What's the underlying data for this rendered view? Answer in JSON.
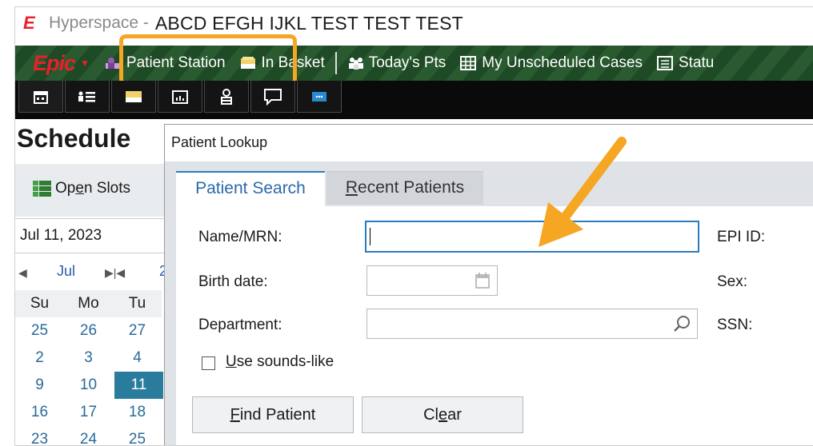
{
  "window": {
    "app_name": "Hyperspace -",
    "patient_name": "ABCD EFGH IJKL TEST TEST TEST"
  },
  "toolbar": {
    "epic_label": "Epic",
    "items": [
      {
        "label": "Patient Station",
        "icon": "patient-station-icon"
      },
      {
        "label": "In Basket",
        "icon": "in-basket-icon"
      },
      {
        "label": "Today's Pts",
        "icon": "todays-pts-icon"
      },
      {
        "label": "My Unscheduled Cases",
        "icon": "unscheduled-cases-icon"
      },
      {
        "label": "Statu",
        "icon": "status-icon"
      }
    ]
  },
  "icon_tabs": [
    "calendar-icon",
    "list-icon",
    "inbox-icon",
    "chart-icon",
    "person-icon",
    "chat-icon",
    "message-icon"
  ],
  "schedule": {
    "title": "Schedule",
    "open_slots_prefix": "Op",
    "open_slots_hotkey": "e",
    "open_slots_suffix": "n Slots",
    "date": "Jul 11, 2023",
    "month": "Jul",
    "year_fragment": "2",
    "weekdays": [
      "Su",
      "Mo",
      "Tu"
    ],
    "weeks": [
      [
        "25",
        "26",
        "27"
      ],
      [
        "2",
        "3",
        "4"
      ],
      [
        "9",
        "10",
        "11"
      ],
      [
        "16",
        "17",
        "18"
      ],
      [
        "23",
        "24",
        "25"
      ]
    ],
    "selected_day": "11"
  },
  "dialog": {
    "title": "Patient Lookup",
    "tabs": {
      "active": "Patient Search",
      "inactive_hotkey": "R",
      "inactive_rest": "ecent Patients"
    },
    "fields": {
      "name_label": "Name/MRN:",
      "name_value": "",
      "birth_label": "Birth date:",
      "birth_value": "",
      "dept_label": "Department:",
      "dept_value": "",
      "epi_label": "EPI ID:",
      "sex_label": "Sex:",
      "ssn_label": "SSN:"
    },
    "sounds_like_hotkey": "U",
    "sounds_like_rest": "se sounds-like",
    "find_hotkey": "F",
    "find_rest": "ind Patient",
    "clear_pre": "Cl",
    "clear_hotkey": "e",
    "clear_post": "ar"
  },
  "colors": {
    "toolbar_green": "#2a5a30",
    "epic_red": "#e8202a",
    "highlight_orange": "#f5a623",
    "focus_blue": "#2a7cc0",
    "today_teal": "#2a7c9c"
  }
}
